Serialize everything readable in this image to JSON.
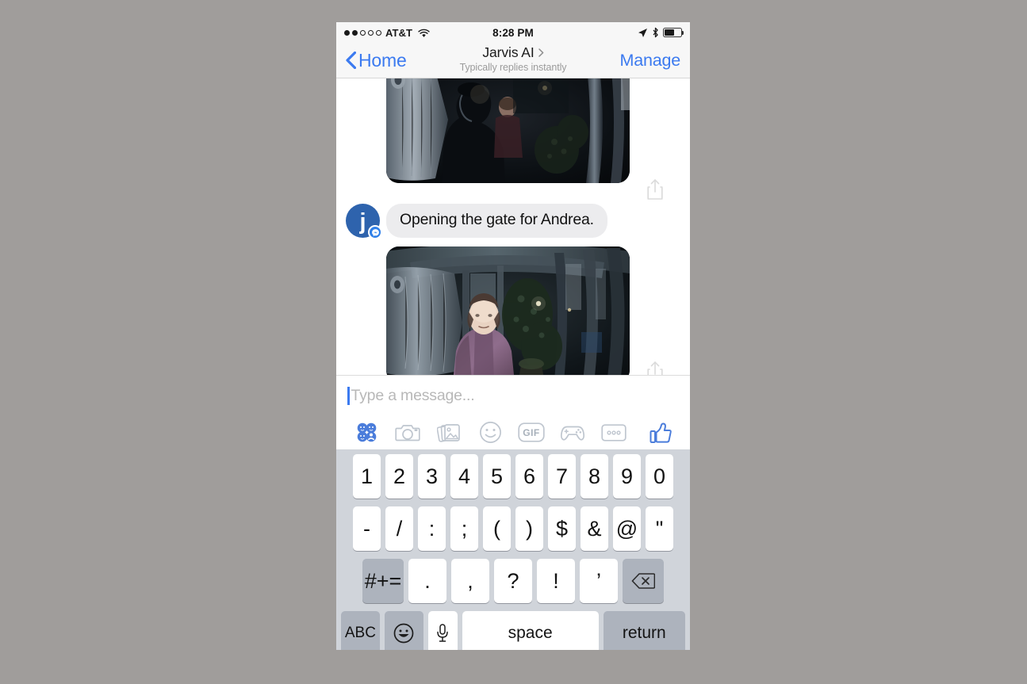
{
  "status_bar": {
    "carrier": "AT&T",
    "signal_dots_filled": 2,
    "signal_dots_total": 5,
    "wifi_icon": "wifi-icon",
    "time": "8:28 PM",
    "location_icon": "location-arrow-icon",
    "bluetooth_icon": "bluetooth-icon",
    "battery_icon": "battery-icon",
    "battery_percent": 62
  },
  "nav": {
    "back_icon": "chevron-left-icon",
    "back_label": "Home",
    "title": "Jarvis AI",
    "title_chevron_icon": "chevron-right-icon",
    "subtitle": "Typically replies instantly",
    "action_label": "Manage"
  },
  "thread": {
    "avatar_letter": "j",
    "avatar_color": "#2e63ad",
    "messenger_badge_icon": "messenger-bolt-icon",
    "messages": [
      {
        "type": "image",
        "name": "doorbell-photo-night-person-at-gate",
        "share_icon": "share-up-icon"
      },
      {
        "type": "text",
        "text": "Opening the gate for Andrea.",
        "bubble_color": "#ececee"
      },
      {
        "type": "image",
        "name": "doorbell-photo-woman-purple-jacket",
        "share_icon": "share-up-icon"
      }
    ]
  },
  "composer": {
    "placeholder": "Type a message...",
    "caret_color": "#3b7af0",
    "icons": [
      {
        "name": "apps-grid-icon",
        "label": "Apps"
      },
      {
        "name": "camera-icon",
        "label": "Camera"
      },
      {
        "name": "photos-icon",
        "label": "Photos"
      },
      {
        "name": "sticker-smiley-icon",
        "label": "Stickers"
      },
      {
        "name": "gif-icon",
        "label": "GIF"
      },
      {
        "name": "gamepad-icon",
        "label": "Games"
      },
      {
        "name": "more-dots-icon",
        "label": "More"
      },
      {
        "name": "thumbs-up-icon",
        "label": "Like"
      }
    ],
    "accent_color": "#4b7ddb"
  },
  "keyboard": {
    "background": "#d0d4da",
    "rows": [
      {
        "name": "number-row",
        "keys": [
          "1",
          "2",
          "3",
          "4",
          "5",
          "6",
          "7",
          "8",
          "9",
          "0"
        ]
      },
      {
        "name": "symbol-row",
        "keys": [
          "-",
          "/",
          ":",
          ";",
          "(",
          ")",
          "$",
          "&",
          "@",
          "\""
        ]
      },
      {
        "name": "punctuation-row",
        "keys": [
          ".",
          ",",
          "?",
          "!",
          "’"
        ]
      }
    ],
    "symbol_toggle": "#+=",
    "delete_icon": "backspace-icon",
    "abc_key": "ABC",
    "emoji_key_icon": "emoji-smiley-icon",
    "mic_key_icon": "microphone-icon",
    "space_key": "space",
    "return_key": "return"
  }
}
